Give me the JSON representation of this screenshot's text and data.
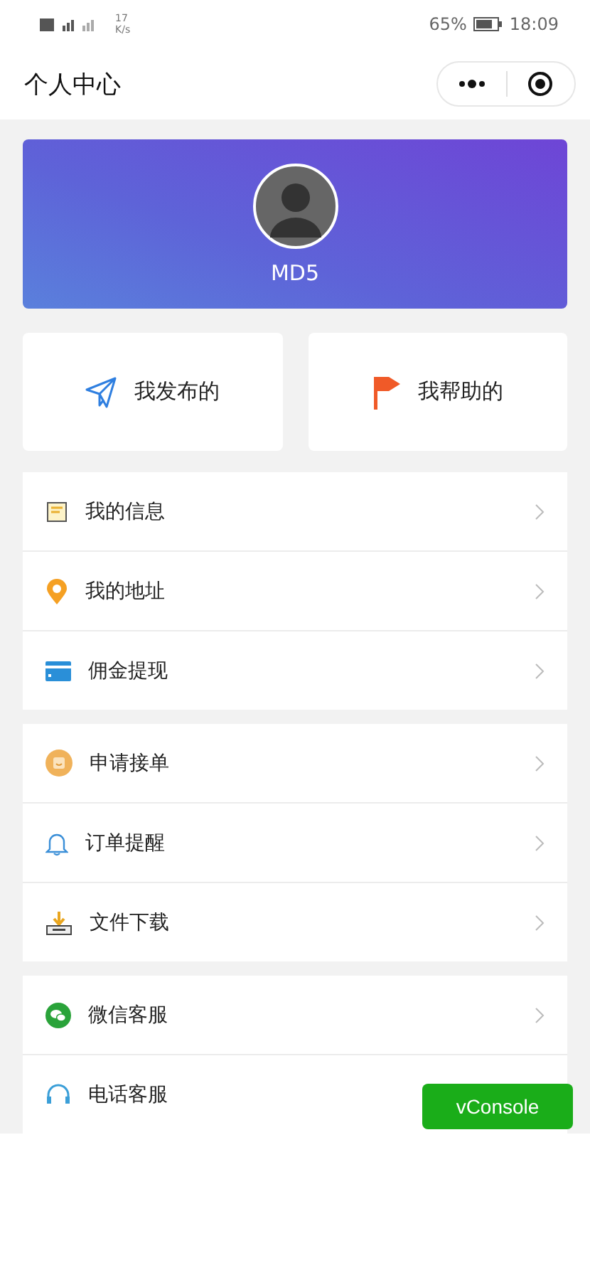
{
  "status_bar": {
    "net_speed": "17",
    "net_unit": "K/s",
    "battery": "65%",
    "time": "18:09"
  },
  "nav": {
    "title": "个人中心"
  },
  "profile": {
    "name": "MD5"
  },
  "actions": [
    {
      "label": "我发布的"
    },
    {
      "label": "我帮助的"
    }
  ],
  "groups": [
    {
      "items": [
        {
          "label": "我的信息",
          "chevron": true
        },
        {
          "label": "我的地址",
          "chevron": true
        },
        {
          "label": "佣金提现",
          "chevron": true
        }
      ]
    },
    {
      "items": [
        {
          "label": "申请接单",
          "chevron": true
        },
        {
          "label": "订单提醒",
          "chevron": true
        },
        {
          "label": "文件下载",
          "chevron": true
        }
      ]
    },
    {
      "items": [
        {
          "label": "微信客服",
          "chevron": true
        },
        {
          "label": "电话客服",
          "chevron": false
        }
      ]
    }
  ],
  "vconsole": {
    "label": "vConsole"
  }
}
